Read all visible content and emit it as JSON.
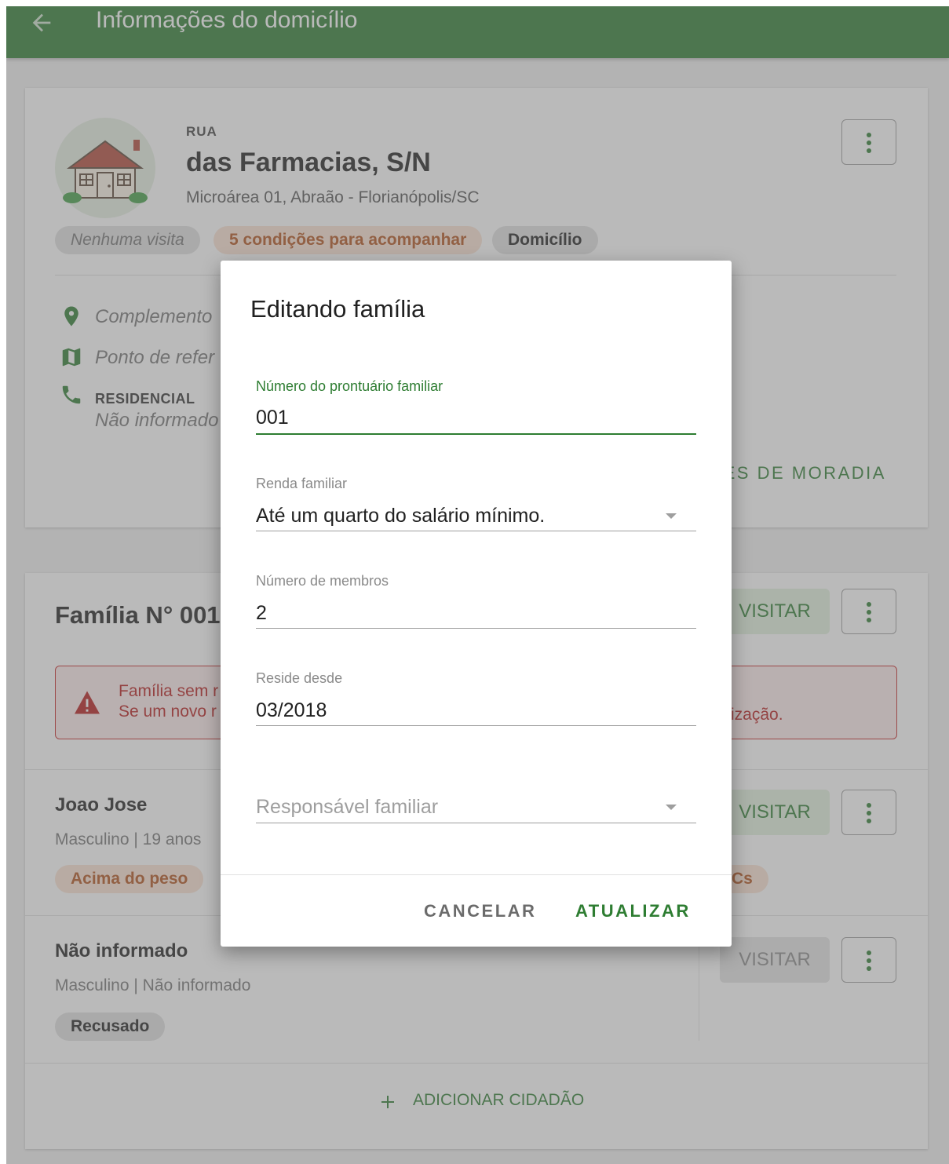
{
  "appbar": {
    "title": "Informações do domicílio"
  },
  "address": {
    "type": "RUA",
    "name": "das Farmacias, S/N",
    "sub": "Microárea 01, Abraão - Florianópolis/SC",
    "chips": [
      "Nenhuma visita",
      "5 condições para acompanhar",
      "Domicílio"
    ],
    "complement": "Complemento",
    "reference": "Ponto de refer",
    "phone_label": "RESIDENCIAL",
    "phone_value": "Não informado",
    "moradia_link": "ÕES DE MORADIA"
  },
  "family": {
    "title": "Família N° 001",
    "visit_label": "VISITAR",
    "alert_line1": "Família sem r",
    "alert_line2": "Se um novo r",
    "alert_tail": "ização.",
    "members": [
      {
        "name": "Joao Jose",
        "sub": "Masculino | 19 anos",
        "chip": "Acima do peso",
        "chip_tail": "Cs"
      },
      {
        "name": "Não informado",
        "sub": "Masculino | Não informado",
        "chip": "Recusado"
      }
    ],
    "add_citizen": "ADICIONAR CIDADÃO"
  },
  "dialog": {
    "title": "Editando família",
    "fields": {
      "prontuario": {
        "label": "Número do prontuário familiar",
        "value": "001"
      },
      "renda": {
        "label": "Renda familiar",
        "value": "Até um quarto do salário mínimo."
      },
      "membros": {
        "label": "Número de membros",
        "value": "2"
      },
      "reside": {
        "label": "Reside desde",
        "value": "03/2018"
      },
      "responsavel": {
        "placeholder": "Responsável familiar"
      }
    },
    "cancel": "CANCELAR",
    "update": "ATUALIZAR"
  },
  "colors": {
    "primary": "#2e7d32",
    "alert": "#c62828",
    "chip_orange": "#b3541e"
  }
}
